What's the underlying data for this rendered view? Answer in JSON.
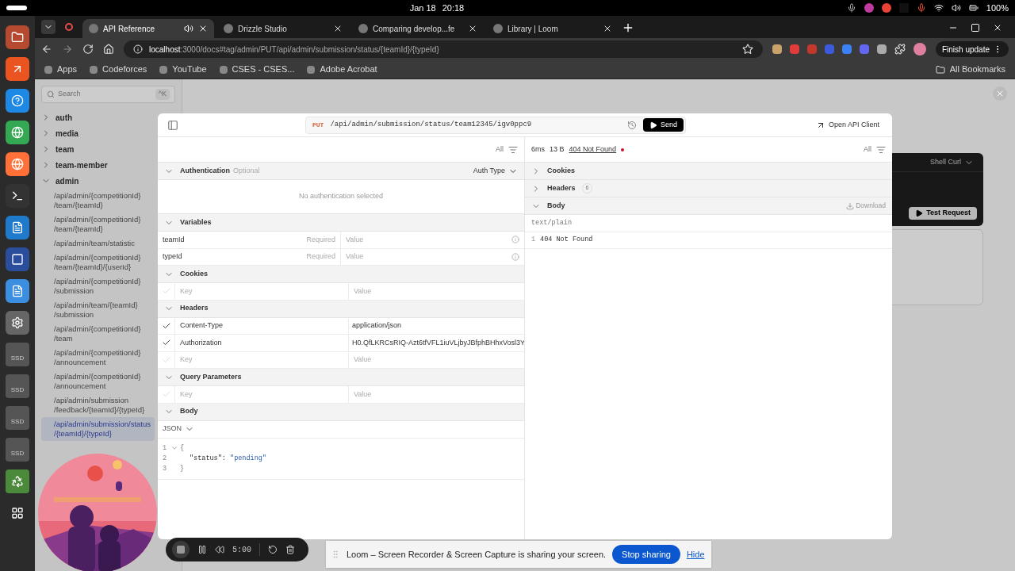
{
  "os_bar": {
    "date": "Jan 18",
    "time": "20:18",
    "battery": "100%"
  },
  "dock": {
    "drive_labels": [
      "SSD",
      "SSD",
      "SSD",
      "SSD"
    ]
  },
  "tabs": [
    {
      "title": "API Reference",
      "selected": true,
      "audio": true
    },
    {
      "title": "Drizzle Studio",
      "selected": false,
      "audio": false
    },
    {
      "title": "Comparing develop...fe",
      "selected": false,
      "audio": false
    },
    {
      "title": "Library | Loom",
      "selected": false,
      "audio": false
    }
  ],
  "address": {
    "host": "localhost",
    "path": ":3000/docs#tag/admin/PUT/api/admin/submission/status/{teamId}/{typeId}"
  },
  "finish_update": "Finish update",
  "bookmarks": [
    "Apps",
    "Codeforces",
    "YouTube",
    "CSES - CSES...",
    "Adobe Acrobat"
  ],
  "all_bookmarks": "All Bookmarks",
  "sidebar": {
    "search_placeholder": "Search",
    "shortcut": "^K",
    "groups": [
      {
        "label": "auth",
        "expanded": false
      },
      {
        "label": "media",
        "expanded": false
      },
      {
        "label": "team",
        "expanded": false
      },
      {
        "label": "team-member",
        "expanded": false
      },
      {
        "label": "admin",
        "expanded": true,
        "children": [
          {
            "label": "/api/admin/{competitionId}/team/{teamId}",
            "selected": false
          },
          {
            "label": "/api/admin/{competitionId}/team/{teamId}",
            "selected": false
          },
          {
            "label": "/api/admin/team/statistic",
            "selected": false
          },
          {
            "label": "/api/admin/{competitionId}/team/{teamId}/{userId}",
            "selected": false
          },
          {
            "label": "/api/admin/{competitionId}/submission",
            "selected": false
          },
          {
            "label": "/api/admin/team/{teamId}/submission",
            "selected": false
          },
          {
            "label": "/api/admin/{competitionId}/team",
            "selected": false
          },
          {
            "label": "/api/admin/{competitionId}/announcement",
            "selected": false
          },
          {
            "label": "/api/admin/{competitionId}/announcement",
            "selected": false
          },
          {
            "label": "/api/admin/submission/feedback/{teamId}/{typeId}",
            "selected": false
          },
          {
            "label": "/api/admin/submission/status/{teamId}/{typeId}",
            "selected": true
          }
        ]
      }
    ]
  },
  "background_card": {
    "language": "Shell Curl",
    "test_button": "Test Request"
  },
  "modal": {
    "method": "PUT",
    "url": "/api/admin/submission/status/team12345/igv0ppc9",
    "send": "Send",
    "open_client": "Open API Client",
    "request": {
      "filter": "All",
      "auth": {
        "title": "Authentication",
        "note": "Optional",
        "type_label": "Auth Type",
        "empty": "No authentication selected",
        "expanded": true
      },
      "variables": {
        "title": "Variables",
        "expanded": true,
        "rows": [
          {
            "name": "teamId",
            "required": "Required",
            "placeholder": "Value"
          },
          {
            "name": "typeId",
            "required": "Required",
            "placeholder": "Value"
          }
        ]
      },
      "cookies": {
        "title": "Cookies",
        "expanded": true,
        "rows": [
          {
            "key_placeholder": "Key",
            "value_placeholder": "Value",
            "enabled": false
          }
        ]
      },
      "headers": {
        "title": "Headers",
        "expanded": true,
        "rows": [
          {
            "key": "Content-Type",
            "value": "application/json",
            "enabled": true
          },
          {
            "key": "Authorization",
            "value": "H0.QfLKRCsRIQ-Azt6tfVFL1iuVLjbyJBfphBHhxVosl3Y",
            "enabled": true
          },
          {
            "key_placeholder": "Key",
            "value_placeholder": "Value",
            "enabled": false
          }
        ]
      },
      "query": {
        "title": "Query Parameters",
        "expanded": true,
        "rows": [
          {
            "key_placeholder": "Key",
            "value_placeholder": "Value",
            "enabled": false
          }
        ]
      },
      "body": {
        "title": "Body",
        "expanded": true,
        "format": "JSON",
        "lines": [
          {
            "number": "1",
            "kind": "brace",
            "text": "{",
            "foldable": true
          },
          {
            "number": "2",
            "kind": "pair",
            "key": "\"status\":",
            "value": "\"pending\""
          },
          {
            "number": "3",
            "kind": "brace",
            "text": "}",
            "foldable": false
          }
        ]
      }
    },
    "response": {
      "time": "6ms",
      "size": "13 B",
      "status": "404 Not Found",
      "filter": "All",
      "sections": [
        {
          "title": "Cookies",
          "expanded": false
        },
        {
          "title": "Headers",
          "expanded": false,
          "count": "6"
        },
        {
          "title": "Body",
          "expanded": true,
          "download": "Download"
        }
      ],
      "content_type": "text/plain",
      "lines": [
        {
          "number": "1",
          "text": "404 Not Found"
        }
      ]
    }
  },
  "loom": {
    "timer": "5:00",
    "message": "Loom – Screen Recorder & Screen Capture is sharing your screen.",
    "stop": "Stop sharing",
    "hide": "Hide"
  }
}
